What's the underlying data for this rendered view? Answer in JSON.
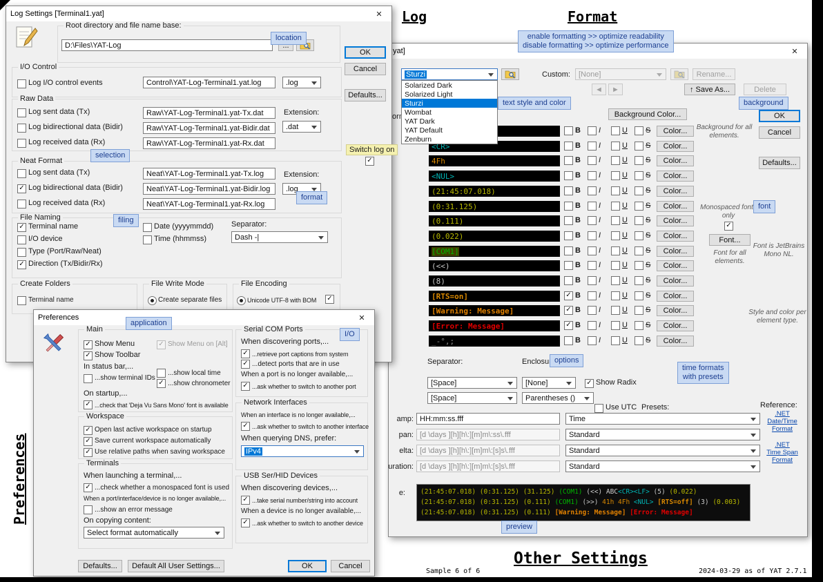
{
  "page": {
    "header_log": "Log",
    "header_format": "Format",
    "header_preferences": "Preferences",
    "header_other": "Other Settings",
    "sample": "Sample 6 of 6",
    "version": "2024-03-29 as of YAT 2.7.1"
  },
  "callouts": {
    "location": "location",
    "selection": "selection",
    "format": "format",
    "filing": "filing",
    "application": "application",
    "io": "I/O",
    "enable1": "enable formatting >> optimize readability",
    "enable2": "disable formatting >> optimize performance",
    "text_style": "text style and color",
    "background": "background",
    "font": "font",
    "options": "options",
    "time1": "time formats",
    "time2": "with presets",
    "preview": "preview"
  },
  "log": {
    "title": "Log Settings [Terminal1.yat]",
    "close": "✕",
    "root_group": "Root directory and file name base:",
    "root_value": "D:\\Files\\YAT-Log",
    "dots": "...",
    "ok": "OK",
    "cancel": "Cancel",
    "defaults": "Defaults...",
    "io_group": "I/O Control",
    "io_check": "Log I/O control events",
    "io_value": "Control\\YAT-Log-Terminal1.yat.log",
    "io_ext": ".log",
    "raw_group": "Raw Data",
    "extension": "Extension:",
    "raw_ext": ".dat",
    "raw_rows": [
      {
        "label": "Log sent data (Tx)",
        "value": "Raw\\YAT-Log-Terminal1.yat-Tx.dat",
        "checked": false
      },
      {
        "label": "Log bidirectional data (Bidir)",
        "value": "Raw\\YAT-Log-Terminal1.yat-Bidir.dat",
        "checked": false
      },
      {
        "label": "Log received data (Rx)",
        "value": "Raw\\YAT-Log-Terminal1.yat-Rx.dat",
        "checked": false
      }
    ],
    "switch_label": "Switch log on",
    "neat_group": "Neat Format",
    "neat_ext": ".log",
    "neat_rows": [
      {
        "label": "Log sent data (Tx)",
        "value": "Neat\\YAT-Log-Terminal1.yat-Tx.log",
        "checked": false
      },
      {
        "label": "Log bidirectional data (Bidir)",
        "value": "Neat\\YAT-Log-Terminal1.yat-Bidir.log",
        "checked": true
      },
      {
        "label": "Log received data (Rx)",
        "value": "Neat\\YAT-Log-Terminal1.yat-Rx.log",
        "checked": false
      }
    ],
    "naming_group": "File Naming",
    "naming_col1": [
      {
        "label": "Terminal name",
        "checked": true
      },
      {
        "label": "I/O device",
        "checked": false
      },
      {
        "label": "Type (Port/Raw/Neat)",
        "checked": false
      },
      {
        "label": "Direction (Tx/Bidir/Rx)",
        "checked": true
      }
    ],
    "naming_col2": [
      {
        "label": "Date (yyyymmdd)",
        "checked": false
      },
      {
        "label": "Time (hhmmss)",
        "checked": false
      }
    ],
    "separator_label": "Separator:",
    "separator_value": "Dash -|",
    "folders_group": "Create Folders",
    "folders_check": "Terminal name",
    "write_group": "File Write Mode",
    "write_option": "Create separate files",
    "encoding_group": "File Encoding",
    "encoding_option": "Unicode UTF-8 with BOM"
  },
  "prefs": {
    "title": "Preferences",
    "close": "✕",
    "main_group": "Main",
    "show_menu": "Show Menu",
    "show_menu_alt": "Show Menu on [Alt]",
    "show_toolbar": "Show Toolbar",
    "in_status_bar": "In status bar,...",
    "show_ids": "...show terminal IDs",
    "show_local_time": "...show local time",
    "show_chrono": "...show chronometer",
    "on_startup": "On startup,...",
    "check_font": "...check that 'Deja Vu Sans Mono' font is available",
    "workspace_group": "Workspace",
    "ws1": "Open last active workspace on startup",
    "ws2": "Save current workspace automatically",
    "ws3": "Use relative paths when saving workspace",
    "terminals_group": "Terminals",
    "t_launch": "When launching a terminal,...",
    "t_mono": "...check whether a monospaced font is used",
    "t_unavail": "When a port/interface/device is no longer available,...",
    "t_error": "...show an error message",
    "t_copy": "On copying content:",
    "t_copy_value": "Select format automatically",
    "serial_group": "Serial COM Ports",
    "s_discover": "When discovering ports,...",
    "s_captions": "...retrieve port captions from system",
    "s_detect": "...detect ports that are in use",
    "s_unavail": "When a port is no longer available,...",
    "s_ask": "...ask whether to switch to another port",
    "net_group": "Network Interfaces",
    "n_unavail": "When an interface is no longer available,...",
    "n_ask": "...ask whether to switch to another interface",
    "n_dns": "When querying DNS, prefer:",
    "n_dns_value": "IPv4",
    "usb_group": "USB Ser/HID Devices",
    "u_discover": "When discovering devices,...",
    "u_serial": "...take serial number/string into account",
    "u_unavail": "When a device is no longer available,...",
    "u_ask": "...ask whether to switch to another device",
    "defaults": "Defaults...",
    "default_all": "Default All User Settings...",
    "ok": "OK",
    "cancel": "Cancel"
  },
  "fmt": {
    "title_fragment": "yat]",
    "close": "✕",
    "enable_fragment": "formatting",
    "preset_value": "Sturzi",
    "preset_selected": "Sturzi",
    "preset_options": [
      "Solarized Dark",
      "Solarized Light",
      "Sturzi",
      "Wombat",
      "YAT Dark",
      "YAT Default",
      "Zenburn"
    ],
    "custom_label": "Custom:",
    "custom_value": "[None]",
    "rename": "Rename...",
    "prev": "◄",
    "next": "►",
    "save_as": "↑ Save As...",
    "delete": "Delete",
    "bg_color": "Background Color...",
    "bg_note": "Background for all elements.",
    "ok": "OK",
    "cancel": "Cancel",
    "defaults": "Defaults...",
    "letters": {
      "b": "B",
      "i": "I",
      "u": "U",
      "s": "S"
    },
    "color_btn": "Color...",
    "rows": [
      {
        "sample": "",
        "c": "data",
        "b": false
      },
      {
        "sample": "<CR>",
        "c": "ctrl",
        "b": false
      },
      {
        "sample": "4Fh",
        "c": "rx",
        "b": false
      },
      {
        "sample": "<NUL>",
        "c": "ctrl",
        "b": false
      },
      {
        "sample": "(21:45:07.018)",
        "c": "time",
        "b": false
      },
      {
        "sample": "(0:31.125)",
        "c": "time",
        "b": false
      },
      {
        "sample": "(0.111)",
        "c": "time",
        "b": false
      },
      {
        "sample": "(0.022)",
        "c": "time",
        "b": false
      },
      {
        "sample": "[COM1]",
        "c": "port",
        "b": false,
        "hl": true
      },
      {
        "sample": "(<<)",
        "c": "dir",
        "b": false
      },
      {
        "sample": "(8)",
        "c": "dir",
        "b": false
      },
      {
        "sample": "[RTS=on]",
        "c": "io",
        "b": true
      },
      {
        "sample": "[Warning: Message]",
        "c": "warn",
        "b": true
      },
      {
        "sample": "[Error: Message]",
        "c": "err",
        "b": true
      },
      {
        "sample": "_-°,;",
        "c": "ws",
        "b": false
      }
    ],
    "colors": {
      "time": "#b8b800",
      "ctrl": "#00b3b3",
      "rx": "#d78700",
      "port": "#00b400",
      "dir": "#c8c8c8",
      "data": "#d0d0d0",
      "len": "#c8c8c8",
      "io": "#d78700",
      "warn": "#e08000",
      "err": "#e00000",
      "ws": "#909090"
    },
    "mono_note": "Monospaced fonts only",
    "font_btn": "Font...",
    "font_note": "Font for all elements.",
    "font_info": "Font is JetBrains Mono NL.",
    "style_note": "Style and color per element type.",
    "sep_label": "Separator:",
    "enc_label": "Enclosure:",
    "sep1": "[Space]",
    "enc1": "[None]",
    "sep2": "[Space]",
    "enc2": "Parentheses ()",
    "show_radix": "Show Radix",
    "use_utc": "Use UTC",
    "presets": "Presets:",
    "reference": "Reference:",
    "trows": [
      {
        "frag": "amp:",
        "value": "HH:mm:ss.fff",
        "preset": "Time",
        "dis": false
      },
      {
        "frag": "pan:",
        "value": "[d \\days ][h][h\\:][m]m\\:ss\\.fff",
        "preset": "Standard",
        "dis": true
      },
      {
        "frag": "elta:",
        "value": "[d \\days ][h][h\\:][m]m\\:[s]s\\.fff",
        "preset": "Standard",
        "dis": true
      },
      {
        "frag": "uration:",
        "value": "[d \\days ][h][h\\:][m]m\\:[s]s\\.fff",
        "preset": "Standard",
        "dis": true
      }
    ],
    "link_dt1": ".NET",
    "link_dt2": "Date/Time Format",
    "link_ts1": ".NET",
    "link_ts2": "Time Span Format",
    "example_frag": "e:",
    "example_lines": [
      [
        {
          "t": "(21:45:07.018) ",
          "c": "time"
        },
        {
          "t": "(0:31.125) ",
          "c": "time"
        },
        {
          "t": "(31.125) ",
          "c": "time"
        },
        {
          "t": "(COM1) ",
          "c": "port"
        },
        {
          "t": "(<<) ",
          "c": "dir"
        },
        {
          "t": "ABC",
          "c": "data"
        },
        {
          "t": "<CR><LF> ",
          "c": "ctrl"
        },
        {
          "t": "(5) ",
          "c": "len"
        },
        {
          "t": "(0.022)",
          "c": "time"
        }
      ],
      [
        {
          "t": "(21:45:07.018) ",
          "c": "time"
        },
        {
          "t": "(0:31.125) ",
          "c": "time"
        },
        {
          "t": "(0.111) ",
          "c": "time"
        },
        {
          "t": "(COM1) ",
          "c": "port"
        },
        {
          "t": "(>>) ",
          "c": "dir"
        },
        {
          "t": "41h 4Fh ",
          "c": "rx"
        },
        {
          "t": "<NUL> ",
          "c": "ctrl"
        },
        {
          "t": "[RTS=off] ",
          "c": "io"
        },
        {
          "t": "(3) ",
          "c": "len"
        },
        {
          "t": "(0.003)",
          "c": "time"
        }
      ],
      [
        {
          "t": "(21:45:07.018) ",
          "c": "time"
        },
        {
          "t": "(0:31.125) ",
          "c": "time"
        },
        {
          "t": "(0.111) ",
          "c": "time"
        },
        {
          "t": "[Warning: Message] ",
          "c": "warn"
        },
        {
          "t": "[Error: Message]",
          "c": "err"
        }
      ]
    ]
  }
}
